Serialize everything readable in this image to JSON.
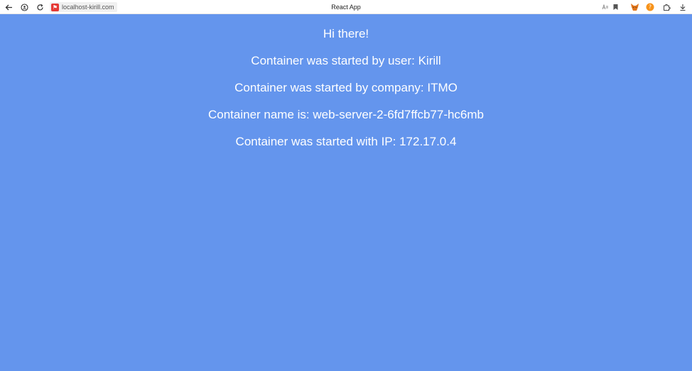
{
  "browser": {
    "url": "localhost-kirill.com",
    "tab_title": "React App",
    "icons": {
      "back": "back-arrow-icon",
      "site_info": "site-info-icon",
      "reload": "reload-icon",
      "favicon": "site-favicon-icon",
      "reader": "reader-mode-icon",
      "bookmark": "bookmark-icon",
      "metamask": "fox-extension-icon",
      "orange_ext": "orange-extension-icon",
      "extensions": "extensions-icon",
      "download": "download-icon"
    }
  },
  "page": {
    "background": "#6495ed",
    "greeting": "Hi there!",
    "user_line": "Container was started by user: Kirill",
    "company_line": "Container was started by company: ITMO",
    "name_line": "Container name is: web-server-2-6fd7ffcb77-hc6mb",
    "ip_line": "Container was started with IP: 172.17.0.4"
  }
}
